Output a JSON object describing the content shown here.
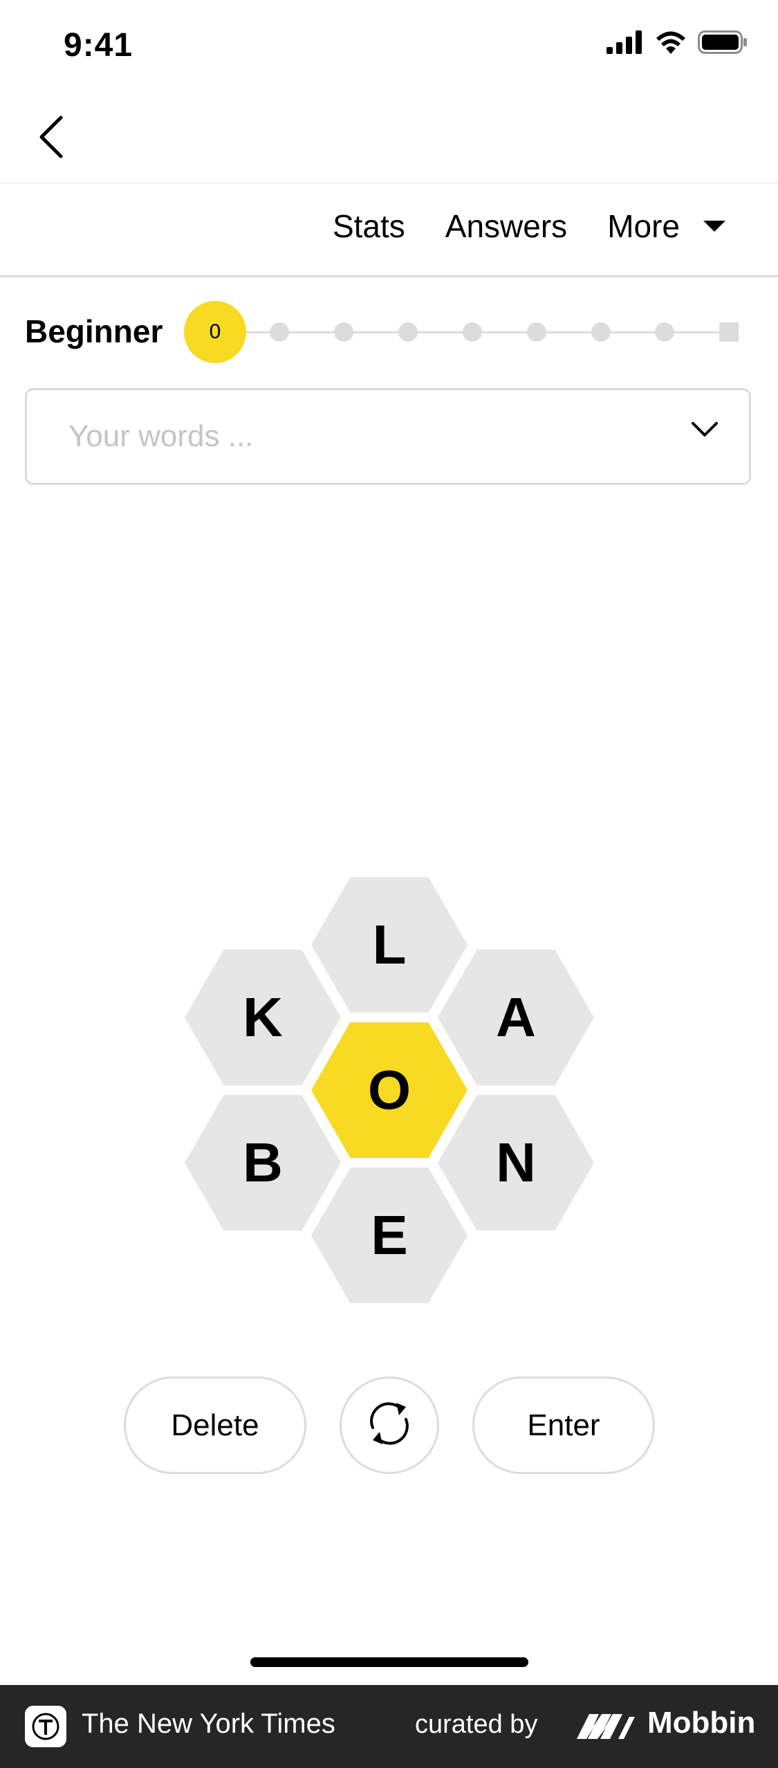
{
  "status_bar": {
    "time": "9:41"
  },
  "toolbar": {
    "stats_label": "Stats",
    "answers_label": "Answers",
    "more_label": "More"
  },
  "progress": {
    "rank": "Beginner",
    "score": "0",
    "highlight_color": "#f7da21"
  },
  "word_list": {
    "placeholder": "Your words ..."
  },
  "hive": {
    "center_letter": "O",
    "outer_letters": [
      "L",
      "K",
      "A",
      "B",
      "N",
      "E"
    ]
  },
  "controls": {
    "delete_label": "Delete",
    "enter_label": "Enter"
  },
  "footer": {
    "brand": "The New York Times",
    "curated_by": "curated by",
    "mobbin": "Mobbin"
  }
}
